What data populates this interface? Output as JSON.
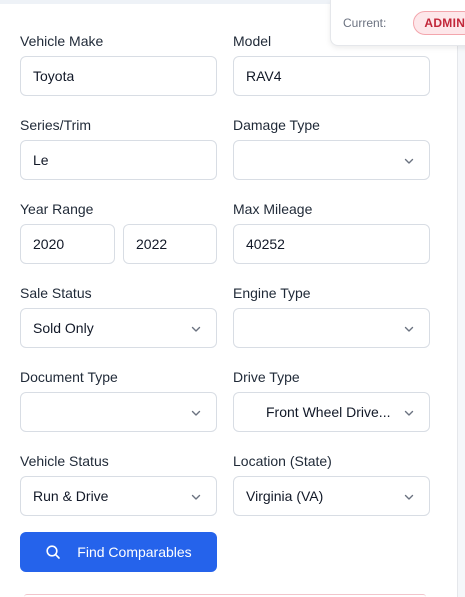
{
  "role": {
    "current_label": "Current:",
    "badge": "ADMIN"
  },
  "form": {
    "make": {
      "label": "Vehicle Make",
      "value": "Toyota"
    },
    "model": {
      "label": "Model",
      "value": "RAV4"
    },
    "series": {
      "label": "Series/Trim",
      "value": "Le"
    },
    "damage": {
      "label": "Damage Type",
      "value": ""
    },
    "year": {
      "label": "Year Range",
      "from": "2020",
      "to": "2022"
    },
    "mileage": {
      "label": "Max Mileage",
      "value": "40252"
    },
    "sale_status": {
      "label": "Sale Status",
      "value": "Sold Only"
    },
    "engine": {
      "label": "Engine Type",
      "value": ""
    },
    "document": {
      "label": "Document Type",
      "value": ""
    },
    "drive": {
      "label": "Drive Type",
      "value": "Front Wheel Drive..."
    },
    "vehicle_status": {
      "label": "Vehicle Status",
      "value": "Run & Drive"
    },
    "location": {
      "label": "Location (State)",
      "value": "Virginia (VA)"
    },
    "submit_label": "Find Comparables"
  },
  "icons": {
    "chevron": "chevron-down-icon",
    "search": "search-icon"
  },
  "colors": {
    "primary": "#2563eb",
    "badge_text": "#c2273a",
    "badge_bg": "#fde7ea"
  }
}
